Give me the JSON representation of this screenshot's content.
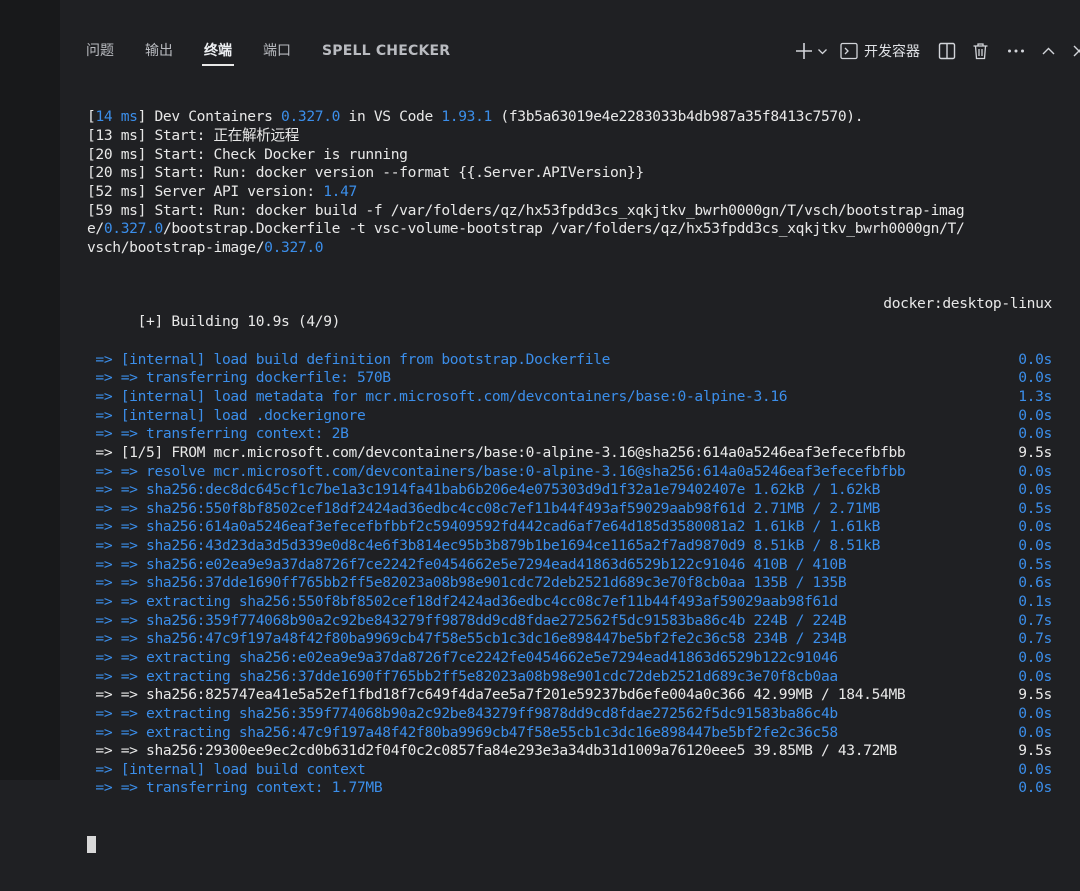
{
  "tabs": [
    {
      "label": "问题"
    },
    {
      "label": "输出"
    },
    {
      "label": "终端"
    },
    {
      "label": "端口"
    },
    {
      "label": "SPELL CHECKER"
    }
  ],
  "toolbar": {
    "devcontainer_label": "开发容器"
  },
  "colors": {
    "background": "#1f2023",
    "text": "#e8e8e8",
    "accent_blue": "#3b8eea"
  },
  "terminal": {
    "header_lines": [
      [
        {
          "t": "["
        },
        {
          "t": "14 ms",
          "c": "num"
        },
        {
          "t": "] Dev Containers "
        },
        {
          "t": "0.327.0",
          "c": "num"
        },
        {
          "t": " in VS Code "
        },
        {
          "t": "1.93.1",
          "c": "num"
        },
        {
          "t": " (f3b5a63019e4e2283033b4db987a35f8413c7570)."
        }
      ],
      [
        {
          "t": "[13 ms] Start: 正在解析远程"
        }
      ],
      [
        {
          "t": "[20 ms] Start: Check Docker is running"
        }
      ],
      [
        {
          "t": "[20 ms] Start: Run: docker version --format {{.Server.APIVersion}}"
        }
      ],
      [
        {
          "t": "[52 ms] Server API version: "
        },
        {
          "t": "1.47",
          "c": "num"
        }
      ],
      [
        {
          "t": "[59 ms] Start: Run: docker build -f /var/folders/qz/hx53fpdd3cs_xqkjtkv_bwrh0000gn/T/vsch/bootstrap-imag"
        }
      ],
      [
        {
          "t": "e/"
        },
        {
          "t": "0.327.0",
          "c": "num"
        },
        {
          "t": "/bootstrap.Dockerfile -t vsc-volume-bootstrap /var/folders/qz/hx53fpdd3cs_xqkjtkv_bwrh0000gn/T/"
        }
      ],
      [
        {
          "t": "vsch/bootstrap-image/"
        },
        {
          "t": "0.327.0",
          "c": "num"
        }
      ]
    ],
    "building_left": "[+] Building 10.9s (4/9)",
    "building_right": "docker:desktop-linux",
    "build_lines": [
      {
        "text": " => [internal] load build definition from bootstrap.Dockerfile",
        "time": "0.0s",
        "color": "blue"
      },
      {
        "text": " => => transferring dockerfile: 570B",
        "time": "0.0s",
        "color": "blue"
      },
      {
        "text": " => [internal] load metadata for mcr.microsoft.com/devcontainers/base:0-alpine-3.16",
        "time": "1.3s",
        "color": "blue"
      },
      {
        "text": " => [internal] load .dockerignore",
        "time": "0.0s",
        "color": "blue"
      },
      {
        "text": " => => transferring context: 2B",
        "time": "0.0s",
        "color": "blue"
      },
      {
        "text": " => [1/5] FROM mcr.microsoft.com/devcontainers/base:0-alpine-3.16@sha256:614a0a5246eaf3efecefbfbb",
        "time": "9.5s",
        "color": "white"
      },
      {
        "text": " => => resolve mcr.microsoft.com/devcontainers/base:0-alpine-3.16@sha256:614a0a5246eaf3efecefbfbb",
        "time": "0.0s",
        "color": "blue"
      },
      {
        "text": " => => sha256:dec8dc645cf1c7be1a3c1914fa41bab6b206e4e075303d9d1f32a1e79402407e 1.62kB / 1.62kB",
        "time": "0.0s",
        "color": "blue"
      },
      {
        "text": " => => sha256:550f8bf8502cef18df2424ad36edbc4cc08c7ef11b44f493af59029aab98f61d 2.71MB / 2.71MB",
        "time": "0.5s",
        "color": "blue"
      },
      {
        "text": " => => sha256:614a0a5246eaf3efecefbfbbf2c59409592fd442cad6af7e64d185d3580081a2 1.61kB / 1.61kB",
        "time": "0.0s",
        "color": "blue"
      },
      {
        "text": " => => sha256:43d23da3d5d339e0d8c4e6f3b814ec95b3b879b1be1694ce1165a2f7ad9870d9 8.51kB / 8.51kB",
        "time": "0.0s",
        "color": "blue"
      },
      {
        "text": " => => sha256:e02ea9e9a37da8726f7ce2242fe0454662e5e7294ead41863d6529b122c91046 410B / 410B",
        "time": "0.5s",
        "color": "blue"
      },
      {
        "text": " => => sha256:37dde1690ff765bb2ff5e82023a08b98e901cdc72deb2521d689c3e70f8cb0aa 135B / 135B",
        "time": "0.6s",
        "color": "blue"
      },
      {
        "text": " => => extracting sha256:550f8bf8502cef18df2424ad36edbc4cc08c7ef11b44f493af59029aab98f61d",
        "time": "0.1s",
        "color": "blue"
      },
      {
        "text": " => => sha256:359f774068b90a2c92be843279ff9878dd9cd8fdae272562f5dc91583ba86c4b 224B / 224B",
        "time": "0.7s",
        "color": "blue"
      },
      {
        "text": " => => sha256:47c9f197a48f42f80ba9969cb47f58e55cb1c3dc16e898447be5bf2fe2c36c58 234B / 234B",
        "time": "0.7s",
        "color": "blue"
      },
      {
        "text": " => => extracting sha256:e02ea9e9a37da8726f7ce2242fe0454662e5e7294ead41863d6529b122c91046",
        "time": "0.0s",
        "color": "blue"
      },
      {
        "text": " => => extracting sha256:37dde1690ff765bb2ff5e82023a08b98e901cdc72deb2521d689c3e70f8cb0aa",
        "time": "0.0s",
        "color": "blue"
      },
      {
        "text": " => => sha256:825747ea41e5a52ef1fbd18f7c649f4da7ee5a7f201e59237bd6efe004a0c366 42.99MB / 184.54MB",
        "time": "9.5s",
        "color": "white"
      },
      {
        "text": " => => extracting sha256:359f774068b90a2c92be843279ff9878dd9cd8fdae272562f5dc91583ba86c4b",
        "time": "0.0s",
        "color": "blue"
      },
      {
        "text": " => => extracting sha256:47c9f197a48f42f80ba9969cb47f58e55cb1c3dc16e898447be5bf2fe2c36c58",
        "time": "0.0s",
        "color": "blue"
      },
      {
        "text": " => => sha256:29300ee9ec2cd0b631d2f04f0c2c0857fa84e293e3a34db31d1009a76120eee5 39.85MB / 43.72MB",
        "time": "9.5s",
        "color": "white"
      },
      {
        "text": " => [internal] load build context",
        "time": "0.0s",
        "color": "blue"
      },
      {
        "text": " => => transferring context: 1.77MB",
        "time": "0.0s",
        "color": "blue"
      }
    ]
  }
}
